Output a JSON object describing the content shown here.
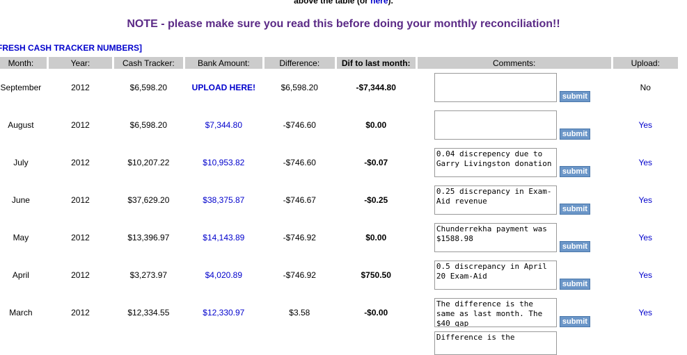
{
  "header": {
    "top_text": "above the table (or ",
    "top_link": "here",
    "top_suffix": ").",
    "note": "NOTE - please make sure you read this before doing your monthly reconciliation!!",
    "refresh_link": "FRESH CASH TRACKER NUMBERS]"
  },
  "table": {
    "headers": [
      "Month:",
      "Year:",
      "Cash Tracker:",
      "Bank Amount:",
      "Difference:",
      "Dif to last month:",
      "Comments:",
      "Upload:"
    ],
    "submit_label": "submit",
    "rows": [
      {
        "month": "September",
        "year": "2012",
        "cash": "$6,598.20",
        "bank": "UPLOAD HERE!",
        "diff": "$6,598.20",
        "dif_last": "-$7,344.80",
        "comment": "",
        "upload": "No"
      },
      {
        "month": "August",
        "year": "2012",
        "cash": "$6,598.20",
        "bank": "$7,344.80",
        "diff": "-$746.60",
        "dif_last": "$0.00",
        "comment": "",
        "upload": "Yes"
      },
      {
        "month": "July",
        "year": "2012",
        "cash": "$10,207.22",
        "bank": "$10,953.82",
        "diff": "-$746.60",
        "dif_last": "-$0.07",
        "comment": "0.04 discrepency due to Garry Livingston donation",
        "upload": "Yes"
      },
      {
        "month": "June",
        "year": "2012",
        "cash": "$37,629.20",
        "bank": "$38,375.87",
        "diff": "-$746.67",
        "dif_last": "-$0.25",
        "comment": "0.25 discrepancy in Exam-Aid revenue",
        "upload": "Yes"
      },
      {
        "month": "May",
        "year": "2012",
        "cash": "$13,396.97",
        "bank": "$14,143.89",
        "diff": "-$746.92",
        "dif_last": "$0.00",
        "comment": "Chunderrekha payment was $1588.98",
        "upload": "Yes"
      },
      {
        "month": "April",
        "year": "2012",
        "cash": "$3,273.97",
        "bank": "$4,020.89",
        "diff": "-$746.92",
        "dif_last": "$750.50",
        "comment": "0.5 discrepancy in April 20 Exam-Aid",
        "upload": "Yes"
      },
      {
        "month": "March",
        "year": "2012",
        "cash": "$12,334.55",
        "bank": "$12,330.97",
        "diff": "$3.58",
        "dif_last": "-$0.00",
        "comment": "The difference is the same as last month. The $40 gap",
        "upload": "Yes"
      }
    ],
    "partial_row_comment": "Difference is the"
  }
}
